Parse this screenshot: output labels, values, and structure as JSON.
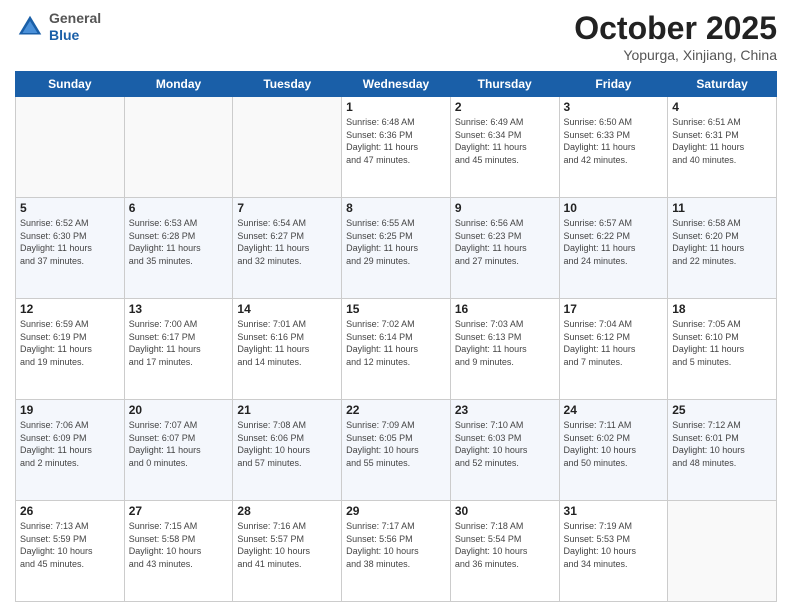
{
  "header": {
    "logo_line1": "General",
    "logo_line2": "Blue",
    "title": "October 2025",
    "location": "Yopurga, Xinjiang, China"
  },
  "weekdays": [
    "Sunday",
    "Monday",
    "Tuesday",
    "Wednesday",
    "Thursday",
    "Friday",
    "Saturday"
  ],
  "weeks": [
    [
      {
        "day": "",
        "info": ""
      },
      {
        "day": "",
        "info": ""
      },
      {
        "day": "",
        "info": ""
      },
      {
        "day": "1",
        "info": "Sunrise: 6:48 AM\nSunset: 6:36 PM\nDaylight: 11 hours\nand 47 minutes."
      },
      {
        "day": "2",
        "info": "Sunrise: 6:49 AM\nSunset: 6:34 PM\nDaylight: 11 hours\nand 45 minutes."
      },
      {
        "day": "3",
        "info": "Sunrise: 6:50 AM\nSunset: 6:33 PM\nDaylight: 11 hours\nand 42 minutes."
      },
      {
        "day": "4",
        "info": "Sunrise: 6:51 AM\nSunset: 6:31 PM\nDaylight: 11 hours\nand 40 minutes."
      }
    ],
    [
      {
        "day": "5",
        "info": "Sunrise: 6:52 AM\nSunset: 6:30 PM\nDaylight: 11 hours\nand 37 minutes."
      },
      {
        "day": "6",
        "info": "Sunrise: 6:53 AM\nSunset: 6:28 PM\nDaylight: 11 hours\nand 35 minutes."
      },
      {
        "day": "7",
        "info": "Sunrise: 6:54 AM\nSunset: 6:27 PM\nDaylight: 11 hours\nand 32 minutes."
      },
      {
        "day": "8",
        "info": "Sunrise: 6:55 AM\nSunset: 6:25 PM\nDaylight: 11 hours\nand 29 minutes."
      },
      {
        "day": "9",
        "info": "Sunrise: 6:56 AM\nSunset: 6:23 PM\nDaylight: 11 hours\nand 27 minutes."
      },
      {
        "day": "10",
        "info": "Sunrise: 6:57 AM\nSunset: 6:22 PM\nDaylight: 11 hours\nand 24 minutes."
      },
      {
        "day": "11",
        "info": "Sunrise: 6:58 AM\nSunset: 6:20 PM\nDaylight: 11 hours\nand 22 minutes."
      }
    ],
    [
      {
        "day": "12",
        "info": "Sunrise: 6:59 AM\nSunset: 6:19 PM\nDaylight: 11 hours\nand 19 minutes."
      },
      {
        "day": "13",
        "info": "Sunrise: 7:00 AM\nSunset: 6:17 PM\nDaylight: 11 hours\nand 17 minutes."
      },
      {
        "day": "14",
        "info": "Sunrise: 7:01 AM\nSunset: 6:16 PM\nDaylight: 11 hours\nand 14 minutes."
      },
      {
        "day": "15",
        "info": "Sunrise: 7:02 AM\nSunset: 6:14 PM\nDaylight: 11 hours\nand 12 minutes."
      },
      {
        "day": "16",
        "info": "Sunrise: 7:03 AM\nSunset: 6:13 PM\nDaylight: 11 hours\nand 9 minutes."
      },
      {
        "day": "17",
        "info": "Sunrise: 7:04 AM\nSunset: 6:12 PM\nDaylight: 11 hours\nand 7 minutes."
      },
      {
        "day": "18",
        "info": "Sunrise: 7:05 AM\nSunset: 6:10 PM\nDaylight: 11 hours\nand 5 minutes."
      }
    ],
    [
      {
        "day": "19",
        "info": "Sunrise: 7:06 AM\nSunset: 6:09 PM\nDaylight: 11 hours\nand 2 minutes."
      },
      {
        "day": "20",
        "info": "Sunrise: 7:07 AM\nSunset: 6:07 PM\nDaylight: 11 hours\nand 0 minutes."
      },
      {
        "day": "21",
        "info": "Sunrise: 7:08 AM\nSunset: 6:06 PM\nDaylight: 10 hours\nand 57 minutes."
      },
      {
        "day": "22",
        "info": "Sunrise: 7:09 AM\nSunset: 6:05 PM\nDaylight: 10 hours\nand 55 minutes."
      },
      {
        "day": "23",
        "info": "Sunrise: 7:10 AM\nSunset: 6:03 PM\nDaylight: 10 hours\nand 52 minutes."
      },
      {
        "day": "24",
        "info": "Sunrise: 7:11 AM\nSunset: 6:02 PM\nDaylight: 10 hours\nand 50 minutes."
      },
      {
        "day": "25",
        "info": "Sunrise: 7:12 AM\nSunset: 6:01 PM\nDaylight: 10 hours\nand 48 minutes."
      }
    ],
    [
      {
        "day": "26",
        "info": "Sunrise: 7:13 AM\nSunset: 5:59 PM\nDaylight: 10 hours\nand 45 minutes."
      },
      {
        "day": "27",
        "info": "Sunrise: 7:15 AM\nSunset: 5:58 PM\nDaylight: 10 hours\nand 43 minutes."
      },
      {
        "day": "28",
        "info": "Sunrise: 7:16 AM\nSunset: 5:57 PM\nDaylight: 10 hours\nand 41 minutes."
      },
      {
        "day": "29",
        "info": "Sunrise: 7:17 AM\nSunset: 5:56 PM\nDaylight: 10 hours\nand 38 minutes."
      },
      {
        "day": "30",
        "info": "Sunrise: 7:18 AM\nSunset: 5:54 PM\nDaylight: 10 hours\nand 36 minutes."
      },
      {
        "day": "31",
        "info": "Sunrise: 7:19 AM\nSunset: 5:53 PM\nDaylight: 10 hours\nand 34 minutes."
      },
      {
        "day": "",
        "info": ""
      }
    ]
  ]
}
